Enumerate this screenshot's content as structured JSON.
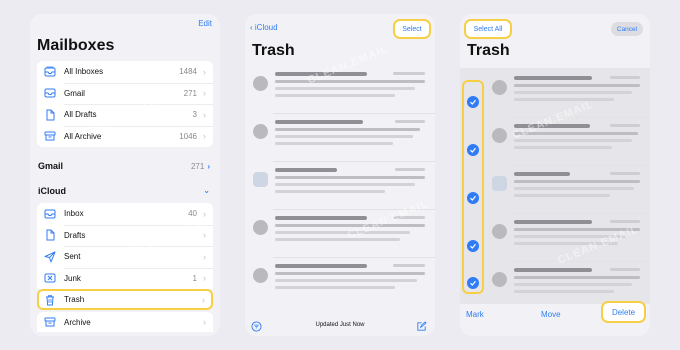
{
  "colors": {
    "accent": "#2f7cf6",
    "highlight": "#f6cf45"
  },
  "watermark": "CLEAN.EMAIL",
  "screen1": {
    "edit_label": "Edit",
    "title": "Mailboxes",
    "top_mailboxes": [
      {
        "icon": "all-inboxes-icon",
        "label": "All Inboxes",
        "count": "1484"
      },
      {
        "icon": "inbox-icon",
        "label": "Gmail",
        "count": "271"
      },
      {
        "icon": "document-icon",
        "label": "All Drafts",
        "count": "3"
      },
      {
        "icon": "archive-icon",
        "label": "All Archive",
        "count": "1046"
      }
    ],
    "gmail_section": {
      "label": "Gmail",
      "count": "271"
    },
    "icloud_section": {
      "label": "iCloud"
    },
    "icloud_mailboxes": [
      {
        "icon": "inbox-icon",
        "label": "Inbox",
        "count": "40"
      },
      {
        "icon": "document-icon",
        "label": "Drafts",
        "count": ""
      },
      {
        "icon": "send-icon",
        "label": "Sent",
        "count": ""
      },
      {
        "icon": "junk-icon",
        "label": "Junk",
        "count": "1"
      }
    ],
    "trash_label": "Trash",
    "archive_label": "Archive"
  },
  "screen2": {
    "back_label": "iCloud",
    "select_label": "Select",
    "title": "Trash",
    "status": "Updated Just Now"
  },
  "screen3": {
    "select_all_label": "Select All",
    "cancel_label": "Cancel",
    "title": "Trash",
    "mark_label": "Mark",
    "move_label": "Move",
    "delete_label": "Delete"
  }
}
